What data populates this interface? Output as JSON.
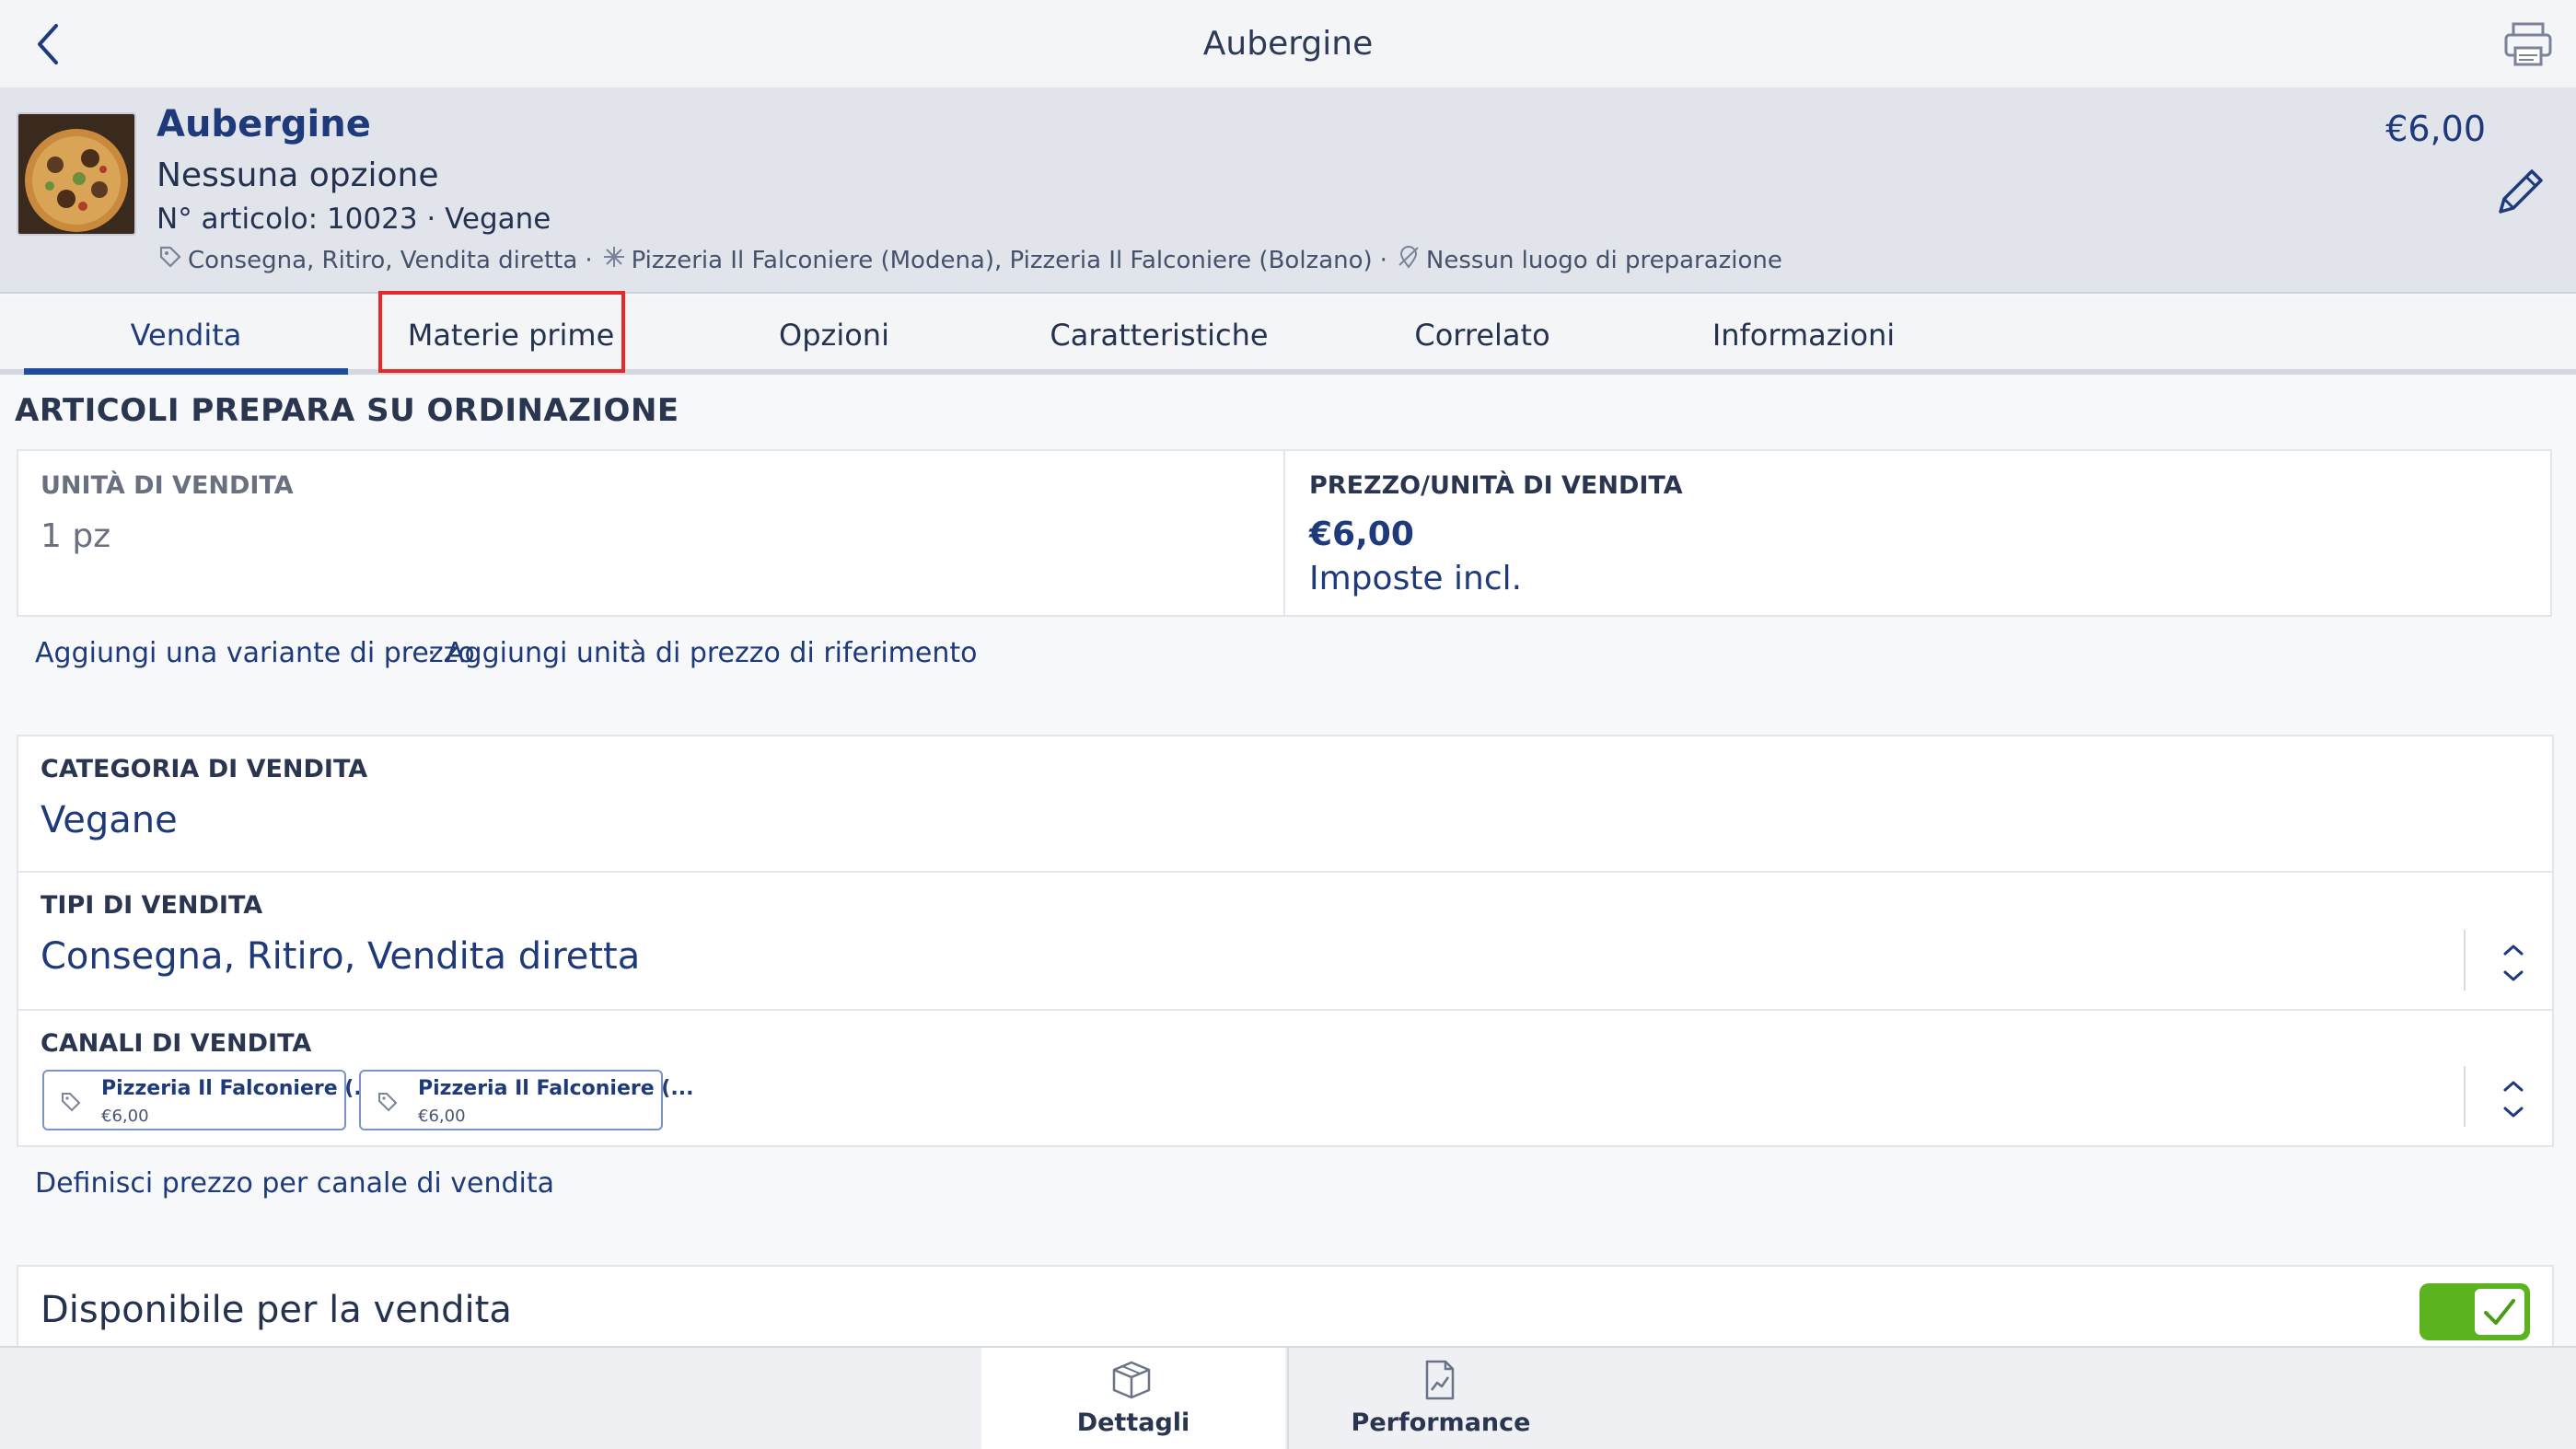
{
  "topbar": {
    "title": "Aubergine"
  },
  "item": {
    "name": "Aubergine",
    "options": "Nessuna opzione",
    "article_line": "N° articolo: 10023 · Vegane",
    "meta_sales_types": "Consegna, Ritiro, Vendita diretta",
    "meta_sep": "·",
    "meta_locations": "Pizzeria Il Falconiere (Modena), Pizzeria Il Falconiere (Bolzano)",
    "meta_prep": "Nessun luogo di preparazione",
    "price": "€6,00"
  },
  "tabs": [
    {
      "label": "Vendita",
      "active": true
    },
    {
      "label": "Materie prime",
      "active": false
    },
    {
      "label": "Opzioni",
      "active": false
    },
    {
      "label": "Caratteristiche",
      "active": false
    },
    {
      "label": "Correlato",
      "active": false
    },
    {
      "label": "Informazioni",
      "active": false
    }
  ],
  "section": {
    "title": "ARTICOLI PREPARA SU ORDINAZIONE"
  },
  "unit": {
    "label": "UNITÀ DI VENDITA",
    "value": "1 pz"
  },
  "price_unit": {
    "label": "PREZZO/UNITÀ DI VENDITA",
    "value": "€6,00",
    "tax_note": "Imposte incl."
  },
  "links": {
    "add_variant": "Aggiungi una variante di prezzo",
    "sep": "·",
    "add_reference": "Aggiungi unità di prezzo di riferimento",
    "define_channel_price": "Definisci prezzo per canale di vendita"
  },
  "category": {
    "label": "CATEGORIA DI VENDITA",
    "value": "Vegane"
  },
  "sale_types": {
    "label": "TIPI DI VENDITA",
    "value": "Consegna, Ritiro, Vendita diretta"
  },
  "channels": {
    "label": "CANALI DI VENDITA",
    "items": [
      {
        "name": "Pizzeria Il Falconiere (...",
        "price": "€6,00"
      },
      {
        "name": "Pizzeria Il Falconiere (...",
        "price": "€6,00"
      }
    ]
  },
  "availability": {
    "label": "Disponibile per la vendita",
    "enabled": true
  },
  "bottom_nav": {
    "details": "Dettagli",
    "performance": "Performance"
  },
  "colors": {
    "accent": "#1f3a7a",
    "active_tab": "#1f4d9e",
    "highlight": "#e6282a",
    "toggle_on": "#5cb320"
  }
}
